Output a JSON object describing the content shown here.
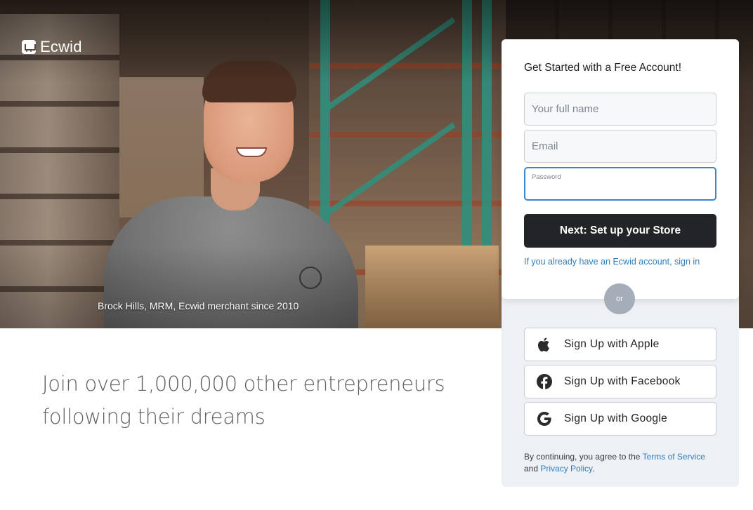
{
  "brand": {
    "name": "Ecwid"
  },
  "hero": {
    "caption": "Brock Hills, MRM, Ecwid merchant since 2010"
  },
  "tagline": {
    "line1": "Join over 1,000,000 other entrepreneurs",
    "line2": "following their dreams"
  },
  "form": {
    "title": "Get Started with a Free Account!",
    "name_placeholder": "Your full name",
    "email_placeholder": "Email",
    "password_label": "Password",
    "password_value": "",
    "next_button": "Next: Set up your Store",
    "signin_link": "If you already have an Ecwid account, sign in"
  },
  "divider": {
    "or": "or"
  },
  "social": {
    "apple": {
      "label": "Sign Up with Apple",
      "icon": "apple-icon"
    },
    "facebook": {
      "label": "Sign Up with Facebook",
      "icon": "facebook-icon"
    },
    "google": {
      "label": "Sign Up with Google",
      "icon": "google-icon"
    }
  },
  "legal": {
    "prefix": "By continuing, you agree to the ",
    "terms": "Terms of Service",
    "and": " and ",
    "privacy": "Privacy Policy",
    "suffix": "."
  },
  "colors": {
    "accent_link": "#2f7fbf",
    "primary_button": "#222427",
    "focus_border": "#3d86c6",
    "panel_bg": "#edf0f4",
    "facebook": "#1877f2"
  }
}
